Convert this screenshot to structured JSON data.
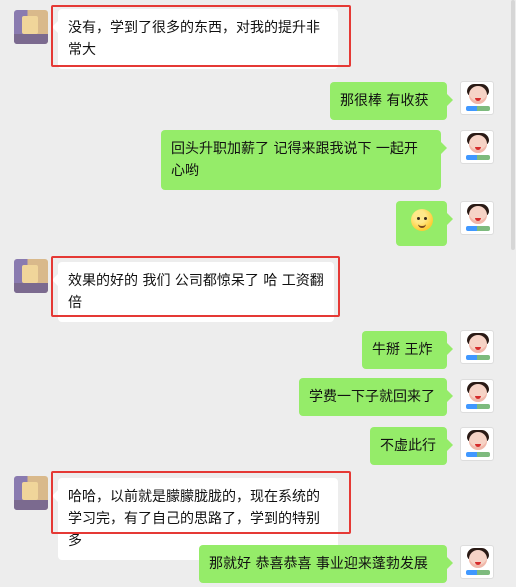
{
  "messages": [
    {
      "side": "left",
      "text": "没有，学到了很多的东西，对我的提升非常大"
    },
    {
      "side": "right",
      "text": "那很棒   有收获"
    },
    {
      "side": "right",
      "text": "回头升职加薪了  记得来跟我说下 一起开心哟"
    },
    {
      "side": "right",
      "text": "",
      "emoji": "thinking-emoji"
    },
    {
      "side": "left",
      "text": "效果的好的  我们  公司都惊呆了  哈   工资翻倍"
    },
    {
      "side": "right",
      "text": "牛掰  王炸"
    },
    {
      "side": "right",
      "text": "学费一下子就回来了"
    },
    {
      "side": "right",
      "text": "不虚此行"
    },
    {
      "side": "left",
      "text": "哈哈，以前就是朦朦胧胧的，现在系统的学习完，有了自己的思路了，学到的特别多"
    },
    {
      "side": "right",
      "text": "那就好  恭喜恭喜  事业迎来蓬勃发展"
    }
  ],
  "colors": {
    "background": "#ededed",
    "right_bubble": "#95ec69",
    "left_bubble": "#ffffff",
    "highlight": "#e53935"
  }
}
